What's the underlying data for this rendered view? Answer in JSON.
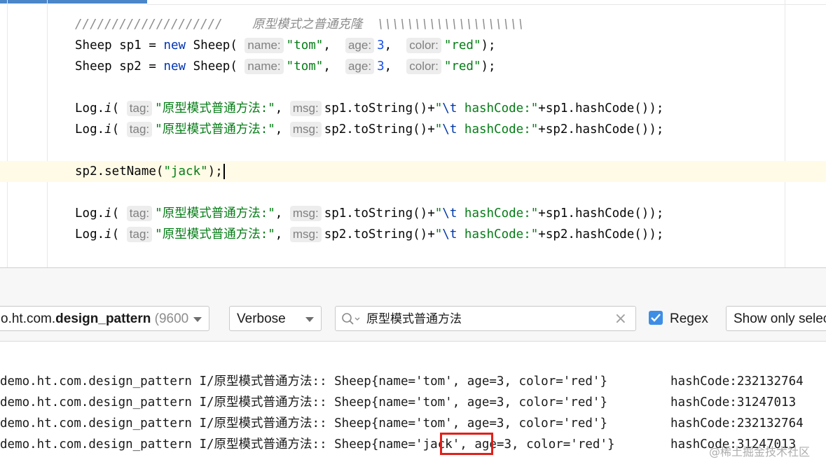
{
  "editor": {
    "comment": {
      "slashes": "////////////////////",
      "text": "原型模式之普通克隆",
      "backslashes": "\\\\\\\\\\\\\\\\\\\\\\\\\\\\\\\\\\\\\\\\"
    },
    "sheep1": {
      "type": "Sheep",
      "var": "sp1",
      "eq": "=",
      "kw_new": "new",
      "ctor": "Sheep(",
      "hint_name": "name:",
      "val_name": "\"tom\"",
      "comma1": ",",
      "hint_age": "age:",
      "val_age": "3",
      "comma2": ",",
      "hint_color": "color:",
      "val_color": "\"red\"",
      "end": ");"
    },
    "sheep2": {
      "type": "Sheep",
      "var": "sp2",
      "eq": "=",
      "kw_new": "new",
      "ctor": "Sheep(",
      "hint_name": "name:",
      "val_name": "\"tom\"",
      "comma1": ",",
      "hint_age": "age:",
      "val_age": "3",
      "comma2": ",",
      "hint_color": "color:",
      "val_color": "\"red\"",
      "end": ");"
    },
    "log_lines": [
      {
        "call": "Log.",
        "method": "i",
        "paren": "(",
        "hint_tag": "tag:",
        "tag": "\"原型模式普通方法:\"",
        "comma": ",",
        "hint_msg": "msg:",
        "expr": "sp1.toString()+",
        "str_open": "\"",
        "esc": "\\t",
        "str_rest": " hashCode:\"",
        "tail": "+sp1.hashCode());"
      },
      {
        "call": "Log.",
        "method": "i",
        "paren": "(",
        "hint_tag": "tag:",
        "tag": "\"原型模式普通方法:\"",
        "comma": ",",
        "hint_msg": "msg:",
        "expr": "sp2.toString()+",
        "str_open": "\"",
        "esc": "\\t",
        "str_rest": " hashCode:\"",
        "tail": "+sp2.hashCode());"
      },
      {
        "call": "Log.",
        "method": "i",
        "paren": "(",
        "hint_tag": "tag:",
        "tag": "\"原型模式普通方法:\"",
        "comma": ",",
        "hint_msg": "msg:",
        "expr": "sp1.toString()+",
        "str_open": "\"",
        "esc": "\\t",
        "str_rest": " hashCode:\"",
        "tail": "+sp1.hashCode());"
      },
      {
        "call": "Log.",
        "method": "i",
        "paren": "(",
        "hint_tag": "tag:",
        "tag": "\"原型模式普通方法:\"",
        "comma": ",",
        "hint_msg": "msg:",
        "expr": "sp2.toString()+",
        "str_open": "\"",
        "esc": "\\t",
        "str_rest": " hashCode:\"",
        "tail": "+sp2.hashCode());"
      }
    ],
    "setname": {
      "call": "sp2.setName(",
      "arg": "\"jack\"",
      "end": ");"
    }
  },
  "logcat": {
    "process_prefix": "o.ht.com.",
    "process_bold": "design_pattern",
    "process_pid": "(9600",
    "level": "Verbose",
    "search_value": "原型模式普通方法",
    "regex_label": "Regex",
    "regex_checked": true,
    "show_only": "Show only selec",
    "entries": [
      {
        "text": "demo.ht.com.design_pattern I/原型模式普通方法:: Sheep{name='tom', age=3, color='red'}",
        "hash": "hashCode:232132764"
      },
      {
        "text": "demo.ht.com.design_pattern I/原型模式普通方法:: Sheep{name='tom', age=3, color='red'}",
        "hash": "hashCode:31247013"
      },
      {
        "text": "demo.ht.com.design_pattern I/原型模式普通方法:: Sheep{name='tom', age=3, color='red'}",
        "hash": "hashCode:232132764"
      },
      {
        "text": "demo.ht.com.design_pattern I/原型模式普通方法:: Sheep{name='jack', age=3, color='red'}",
        "hash": "hashCode:31247013"
      }
    ]
  },
  "watermark": "@稀土掘金技术社区",
  "colors": {
    "highlight": "#e0201b",
    "keyword": "#0033b3",
    "string": "#067d17",
    "checkbox": "#3d8de6"
  }
}
